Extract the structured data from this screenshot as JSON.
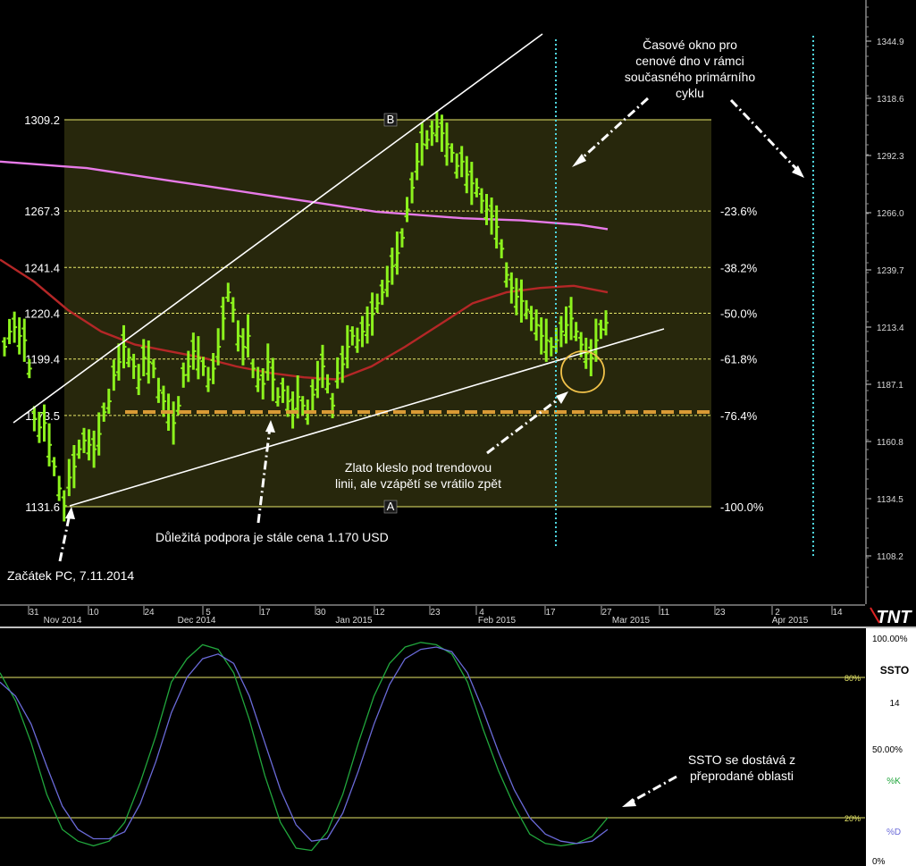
{
  "chart_data": [
    {
      "type": "bar",
      "subtype": "ohlc",
      "price_axis": {
        "ticks": [
          1344.9,
          1318.6,
          1292.3,
          1266.0,
          1239.7,
          1213.4,
          1187.1,
          1160.8,
          1134.5,
          1108.2
        ],
        "ylim": [
          1100.0,
          1360.0
        ]
      },
      "time_axis": {
        "day_labels": [
          "31",
          "10",
          "24",
          "5",
          "17",
          "30",
          "12",
          "23",
          "4",
          "17",
          "27",
          "11",
          "23",
          "2",
          "14"
        ],
        "month_labels": [
          "Nov 2014",
          "Dec 2014",
          "Jan 2015",
          "Feb 2015",
          "Mar 2015",
          "Apr 2015"
        ]
      },
      "price_bars": [
        1205,
        1212,
        1214,
        1210,
        1208,
        1195,
        1172,
        1168,
        1170,
        1160,
        1150,
        1140,
        1132,
        1145,
        1150,
        1158,
        1162,
        1160,
        1158,
        1165,
        1175,
        1180,
        1192,
        1198,
        1205,
        1200,
        1196,
        1190,
        1200,
        1198,
        1195,
        1185,
        1180,
        1175,
        1170,
        1178,
        1192,
        1196,
        1203,
        1200,
        1196,
        1190,
        1195,
        1205,
        1218,
        1230,
        1222,
        1210,
        1205,
        1210,
        1195,
        1190,
        1188,
        1198,
        1190,
        1182,
        1185,
        1180,
        1176,
        1182,
        1178,
        1175,
        1183,
        1190,
        1196,
        1188,
        1178,
        1193,
        1197,
        1205,
        1210,
        1208,
        1212,
        1215,
        1220,
        1225,
        1230,
        1235,
        1242,
        1248,
        1255,
        1268,
        1278,
        1290,
        1298,
        1300,
        1303,
        1306,
        1303,
        1298,
        1294,
        1288,
        1290,
        1284,
        1280,
        1278,
        1272,
        1268,
        1265,
        1260,
        1250,
        1238,
        1232,
        1228,
        1226,
        1222,
        1218,
        1215,
        1210,
        1208,
        1205,
        1208,
        1212,
        1215,
        1218,
        1212,
        1206,
        1202,
        1200,
        1208,
        1213,
        1216
      ],
      "range_high": 1309.2,
      "range_low": 1131.6,
      "range_labels": [
        "B",
        "A"
      ],
      "levels": [
        {
          "price": 1309.2,
          "label": "1309.2",
          "pct": ""
        },
        {
          "price": 1267.3,
          "label": "1267.3",
          "pct": "-23.6%"
        },
        {
          "price": 1241.4,
          "label": "1241.4",
          "pct": "-38.2%"
        },
        {
          "price": 1220.4,
          "label": "1220.4",
          "pct": "-50.0%"
        },
        {
          "price": 1199.4,
          "label": "1199.4",
          "pct": "-61.8%"
        },
        {
          "price": 1173.5,
          "label": "1173.5",
          "pct": "-76.4%"
        },
        {
          "price": 1131.6,
          "label": "1131.6",
          "pct": "-100.0%"
        }
      ],
      "support_price": 1173.5,
      "moving_average_magenta": [
        1290,
        1289,
        1288,
        1287,
        1285,
        1283,
        1281,
        1279,
        1277,
        1275,
        1273,
        1271,
        1269,
        1267,
        1266,
        1265,
        1264,
        1263.5,
        1263,
        1262,
        1261,
        1259
      ],
      "moving_average_red": [
        1245,
        1235,
        1222,
        1212,
        1206,
        1203,
        1200,
        1196,
        1193,
        1191,
        1190,
        1196,
        1205,
        1215,
        1225,
        1230,
        1232,
        1233,
        1230
      ],
      "colors": {
        "bars": "#8cf21d",
        "fib_fill": "#27270c",
        "fib_lines": "#e8e86a",
        "ma_magenta": "#e77ae8",
        "ma_red": "#b42727",
        "support": "#d99a35",
        "cycle_lines": "#4fd6df",
        "trend": "#ffffff",
        "circle": "#f1c24a"
      }
    },
    {
      "type": "line",
      "title": "SSTO",
      "period": "14",
      "legend": [
        "%K",
        "%D"
      ],
      "ylim": [
        0,
        100
      ],
      "y_ticks_right": [
        "100.00%",
        "50.00%",
        "0%"
      ],
      "levels": [
        {
          "value": 80,
          "label": "80%"
        },
        {
          "value": 20,
          "label": "20%"
        }
      ],
      "series": [
        {
          "name": "%K",
          "color": "#21a63c",
          "values": [
            82,
            70,
            52,
            30,
            15,
            10,
            8,
            10,
            18,
            35,
            55,
            78,
            88,
            94,
            92,
            82,
            62,
            38,
            18,
            7,
            6,
            14,
            30,
            52,
            72,
            86,
            93,
            95,
            94,
            90,
            78,
            58,
            40,
            25,
            13,
            9,
            8,
            9,
            12,
            20
          ]
        },
        {
          "name": "%D",
          "color": "#6a6ad8",
          "values": [
            78,
            72,
            60,
            42,
            25,
            15,
            11,
            11,
            14,
            26,
            44,
            65,
            80,
            88,
            90,
            86,
            72,
            52,
            32,
            17,
            10,
            11,
            22,
            40,
            60,
            77,
            88,
            92,
            93,
            91,
            82,
            66,
            48,
            32,
            20,
            13,
            10,
            9,
            10,
            15
          ]
        }
      ]
    }
  ],
  "annotations": {
    "cycle_window": [
      "Časové okno pro",
      "cenové dno v rámci",
      "současného primárního",
      "cyklu"
    ],
    "trendline_break": [
      "Zlato kleslo pod trendovou",
      "linii, ale vzápětí se vrátilo zpět"
    ],
    "support_note": "Důležitá podpora je stále cena 1.170 USD",
    "start_note": "Začátek PC, 7.11.2014",
    "ssto_note": [
      "SSTO se dostává z",
      "přeprodané oblasti"
    ],
    "logo": "TNT"
  }
}
